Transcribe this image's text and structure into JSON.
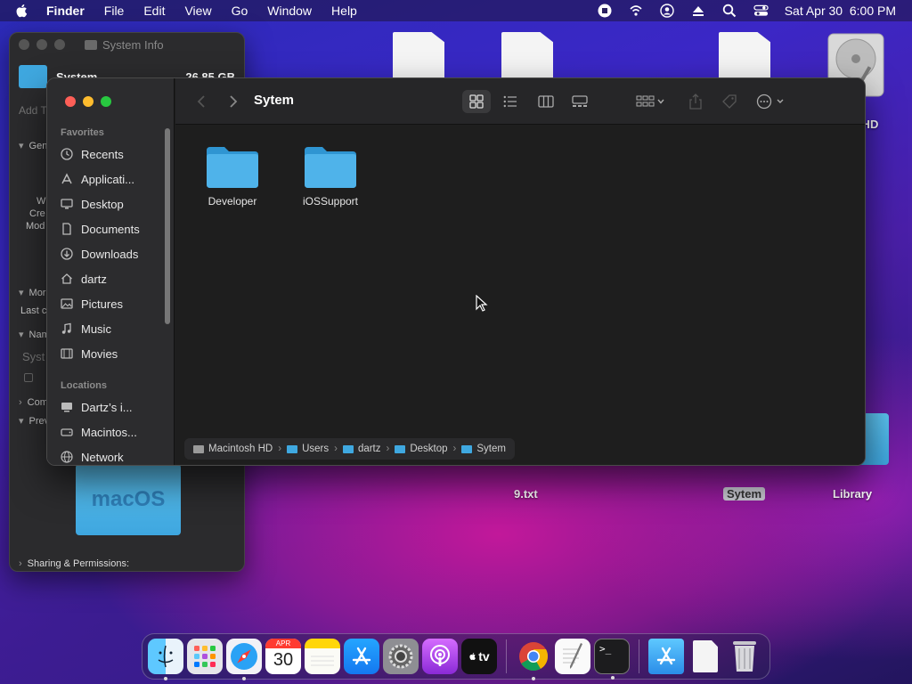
{
  "menubar": {
    "items": [
      {
        "label": "Finder",
        "bold": true
      },
      {
        "label": "File"
      },
      {
        "label": "Edit"
      },
      {
        "label": "View"
      },
      {
        "label": "Go"
      },
      {
        "label": "Window"
      },
      {
        "label": "Help"
      }
    ],
    "clock": "Sat Apr 30  6:00 PM"
  },
  "desktop": {
    "icons": [
      {
        "label": "9.txt"
      },
      {
        "label": "Sytem",
        "selected": true
      },
      {
        "label": "Library"
      },
      {
        "label": "h HD"
      }
    ]
  },
  "info_window": {
    "title": "System Info",
    "name": "System",
    "size": "26.85 GB",
    "add_tags": "Add Ta",
    "rows": [
      "Gen",
      "W",
      "Cre",
      "Mod",
      "Mor",
      "Last c",
      "Nam",
      "Syst",
      "Com",
      "Prev"
    ],
    "preview_text": "macOS",
    "sharing": "Sharing & Permissions:"
  },
  "finder": {
    "title": "Sytem",
    "sidebar": {
      "favorites_label": "Favorites",
      "favorites": [
        {
          "label": "Recents",
          "icon": "clock-icon"
        },
        {
          "label": "Applicati...",
          "icon": "applications-icon"
        },
        {
          "label": "Desktop",
          "icon": "desktop-icon"
        },
        {
          "label": "Documents",
          "icon": "document-icon"
        },
        {
          "label": "Downloads",
          "icon": "download-icon"
        },
        {
          "label": "dartz",
          "icon": "home-icon"
        },
        {
          "label": "Pictures",
          "icon": "picture-icon"
        },
        {
          "label": "Music",
          "icon": "music-icon"
        },
        {
          "label": "Movies",
          "icon": "movie-icon"
        }
      ],
      "locations_label": "Locations",
      "locations": [
        {
          "label": "Dartz’s i...",
          "icon": "computer-icon"
        },
        {
          "label": "Macintos...",
          "icon": "disk-icon"
        },
        {
          "label": "Network",
          "icon": "network-icon"
        }
      ]
    },
    "folders": [
      {
        "label": "Developer"
      },
      {
        "label": "iOSSupport"
      }
    ],
    "pathbar": [
      "Macintosh HD",
      "Users",
      "dartz",
      "Desktop",
      "Sytem"
    ]
  },
  "dock": {
    "calendar_month": "APR",
    "calendar_day": "30",
    "tv_label": "tv"
  },
  "colors": {
    "accent": "#3fa8e0",
    "close": "#fe5f57",
    "minimize": "#febc2e",
    "maximize": "#28c840"
  }
}
